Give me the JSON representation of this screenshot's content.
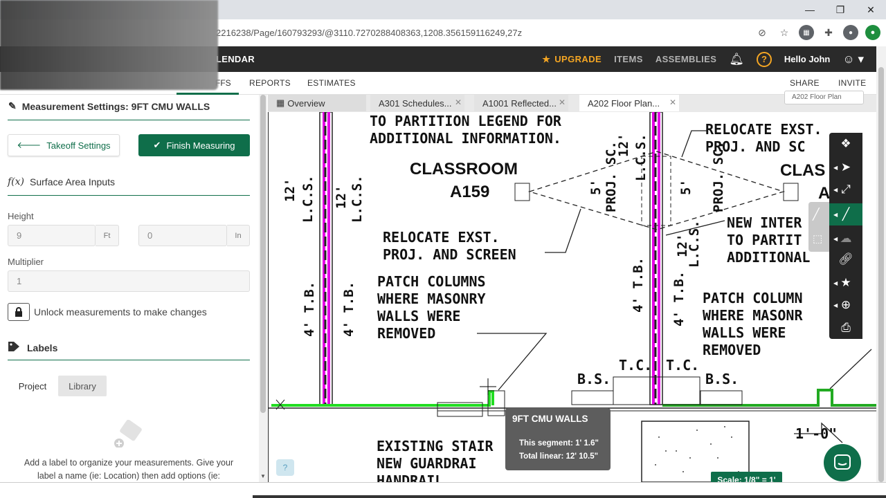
{
  "browser": {
    "url": "2216238/Page/160793293/@3110.7270288408363,1208.356159116249,27z",
    "window_controls": [
      "—",
      "❐",
      "✕"
    ]
  },
  "topnav": {
    "brand_fragment": "LENDAR",
    "upgrade": "UPGRADE",
    "items": "ITEMS",
    "assemblies": "ASSEMBLIES",
    "greeting": "Hello John"
  },
  "subnav": {
    "takeoffs_fragment": "FFS",
    "reports": "REPORTS",
    "estimates": "ESTIMATES",
    "share": "SHARE",
    "invite": "INVITE"
  },
  "panel": {
    "title": "Measurement Settings: 9FT CMU WALLS",
    "takeoff_settings": "Takeoff Settings",
    "finish_measuring": "Finish Measuring",
    "surface_area_inputs": "Surface Area Inputs",
    "height_label": "Height",
    "height_ft": "9",
    "ft_unit": "Ft",
    "height_in": "0",
    "in_unit": "In",
    "multiplier_label": "Multiplier",
    "multiplier": "1",
    "unlock": "Unlock measurements to make changes",
    "labels": "Labels",
    "tab_project": "Project",
    "tab_library": "Library",
    "empty_text": "Add a label to organize your measurements. Give your label a name (ie: Location) then add options (ie:"
  },
  "doc_tabs": {
    "overview": "Overview",
    "a301": "A301 Schedules...",
    "a1001": "A1001 Reflected...",
    "a202": "A202 Floor Plan...",
    "page_select": "A202 Floor Plan"
  },
  "drawing": {
    "t1": "TO PARTITION LEGEND FOR",
    "t2": "ADDITIONAL INFORMATION.",
    "classroom": "CLASSROOM",
    "room": "A159",
    "reloc1": "RELOCATE EXST.",
    "reloc2": "PROJ. AND SCREEN",
    "patch1": "PATCH COLUMNS",
    "patch2": "WHERE MASONRY",
    "patch3": "WALLS WERE",
    "patch4": "REMOVED",
    "r_reloc1": "RELOCATE EXST.",
    "r_reloc2": "PROJ. AND SC",
    "r_class": "CLAS",
    "r_new1": "NEW INTER",
    "r_new2": "TO PARTIT",
    "r_new3": "ADDITIONAL",
    "r_patch1": "PATCH COLUMN",
    "r_patch2": "WHERE MASONR",
    "r_patch3": "WALLS WERE",
    "r_patch4": "REMOVED",
    "tc": "T.C.",
    "bs": "B.S.",
    "stair1": "EXISTING STAIR",
    "stair2": "NEW GUARDRAI",
    "stair3": "HANDRAIL",
    "dim": "1'-0\"",
    "lcs": "L.C.S.",
    "twelve": "12'",
    "tb": "4' T.B.",
    "five": "5'",
    "projsc": "PROJ. SC.",
    "a_frag": "A"
  },
  "tooltip": {
    "title": "9FT CMU WALLS",
    "segment": "This segment: 1' 1.6\"",
    "total": "Total linear: 12' 10.5\""
  },
  "scale": "Scale: 1/8\" = 1'",
  "colors": {
    "brand_green": "#0f6e4a",
    "upgrade": "#f5a623",
    "wall_magenta": "#e600e6",
    "measure_green": "#22dd22"
  }
}
